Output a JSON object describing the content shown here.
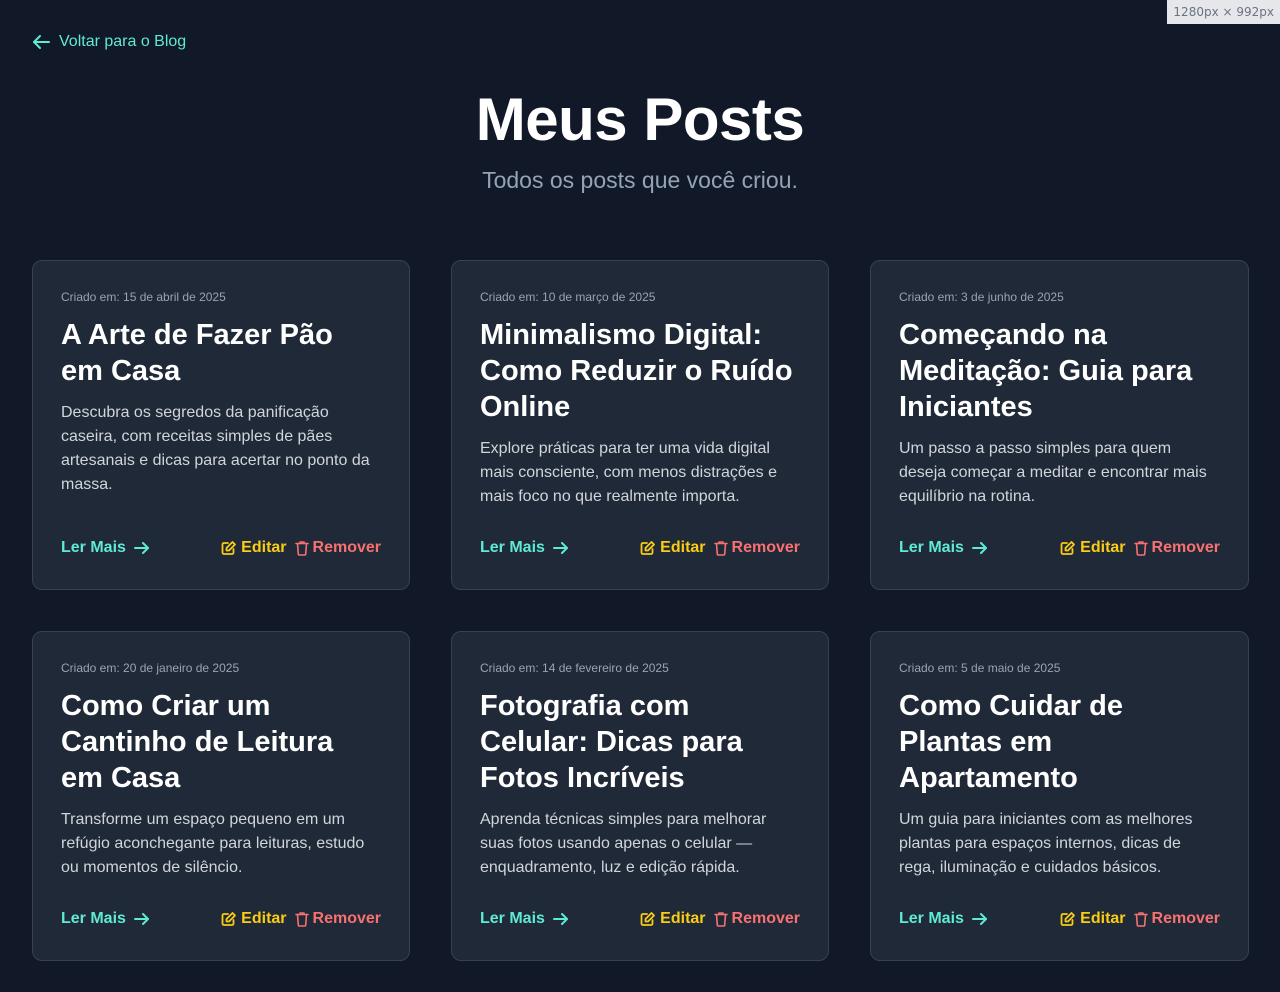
{
  "browser_overlay": {
    "dimensions": "1280px × 992px"
  },
  "back_link": {
    "label": "Voltar para o Blog",
    "icon": "arrow-left-icon"
  },
  "header": {
    "title": "Meus Posts",
    "subtitle": "Todos os posts que você criou."
  },
  "colors": {
    "background": "#111827",
    "card": "#1f2937",
    "accent": "#5eead4",
    "edit": "#facc15",
    "remove": "#f87171"
  },
  "actions": {
    "read_more": "Ler Mais",
    "edit": "Editar",
    "remove": "Remover",
    "read_more_icon": "arrow-right-icon",
    "edit_icon": "pencil-square-icon",
    "remove_icon": "trash-icon"
  },
  "posts": [
    {
      "date": "Criado em: 15 de abril de 2025",
      "title": "A Arte de Fazer Pão em Casa",
      "description": "Descubra os segredos da panificação caseira, com receitas simples de pães artesanais e dicas para acertar no ponto da massa."
    },
    {
      "date": "Criado em: 10 de março de 2025",
      "title": "Minimalismo Digital: Como Reduzir o Ruído Online",
      "description": "Explore práticas para ter uma vida digital mais consciente, com menos distrações e mais foco no que realmente importa."
    },
    {
      "date": "Criado em: 3 de junho de 2025",
      "title": "Começando na Meditação: Guia para Iniciantes",
      "description": "Um passo a passo simples para quem deseja começar a meditar e encontrar mais equilíbrio na rotina."
    },
    {
      "date": "Criado em: 20 de janeiro de 2025",
      "title": "Como Criar um Cantinho de Leitura em Casa",
      "description": "Transforme um espaço pequeno em um refúgio aconchegante para leituras, estudo ou momentos de silêncio."
    },
    {
      "date": "Criado em: 14 de fevereiro de 2025",
      "title": "Fotografia com Celular: Dicas para Fotos Incríveis",
      "description": "Aprenda técnicas simples para melhorar suas fotos usando apenas o celular — enquadramento, luz e edição rápida."
    },
    {
      "date": "Criado em: 5 de maio de 2025",
      "title": "Como Cuidar de Plantas em Apartamento",
      "description": "Um guia para iniciantes com as melhores plantas para espaços internos, dicas de rega, iluminação e cuidados básicos."
    }
  ]
}
